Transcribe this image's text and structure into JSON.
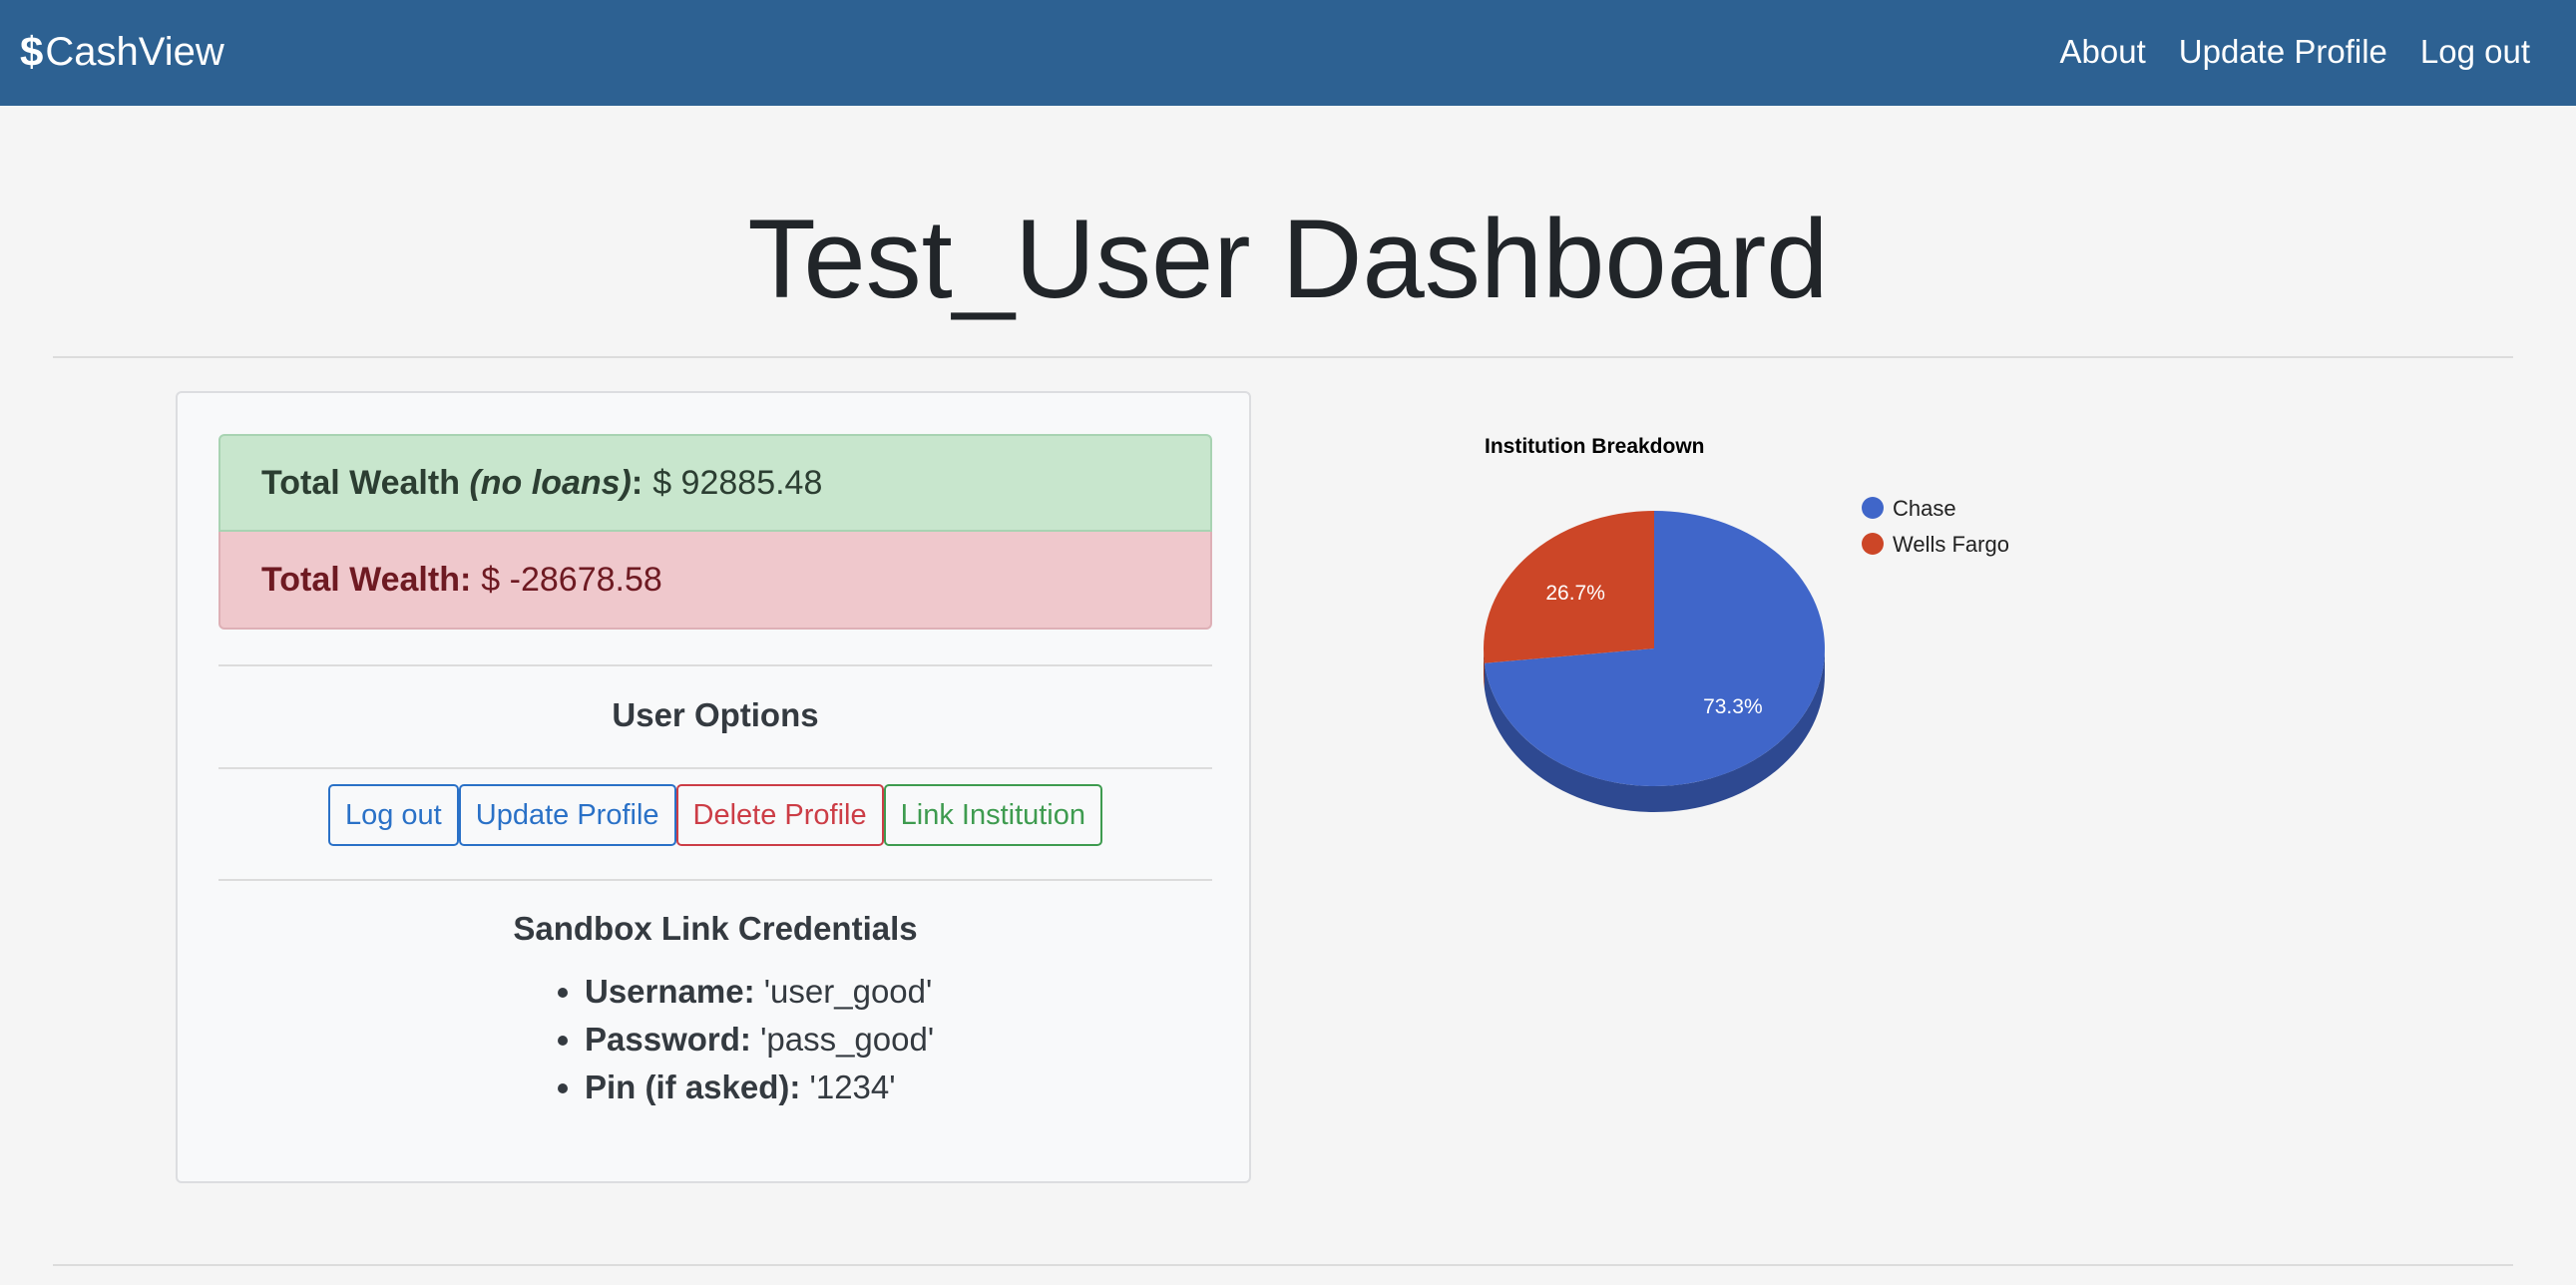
{
  "app": {
    "brand_symbol": "$",
    "brand_name": "CashView"
  },
  "nav": {
    "items": [
      "About",
      "Update Profile",
      "Log out"
    ]
  },
  "page": {
    "title": "Test_User Dashboard"
  },
  "wealth": {
    "no_loans_label": "Total Wealth",
    "no_loans_qualifier": "(no loans)",
    "no_loans_value": "$ 92885.48",
    "total_label": "Total Wealth:",
    "total_value": "$ -28678.58"
  },
  "user_options": {
    "title": "User Options",
    "buttons": [
      "Log out",
      "Update Profile",
      "Delete Profile",
      "Link Institution"
    ]
  },
  "sandbox": {
    "title": "Sandbox Link Credentials",
    "items": [
      {
        "key": "Username:",
        "value": "'user_good'"
      },
      {
        "key": "Password:",
        "value": "'pass_good'"
      },
      {
        "key": "Pin (if asked):",
        "value": "'1234'"
      }
    ]
  },
  "chart_data": {
    "type": "pie",
    "title": "Institution Breakdown",
    "categories": [
      "Chase",
      "Wells Fargo"
    ],
    "values": [
      73.3,
      26.7
    ],
    "labels": [
      "73.3%",
      "26.7%"
    ],
    "colors": [
      "#4066c9",
      "#cc4627"
    ],
    "legend": "right",
    "style": "3d"
  }
}
